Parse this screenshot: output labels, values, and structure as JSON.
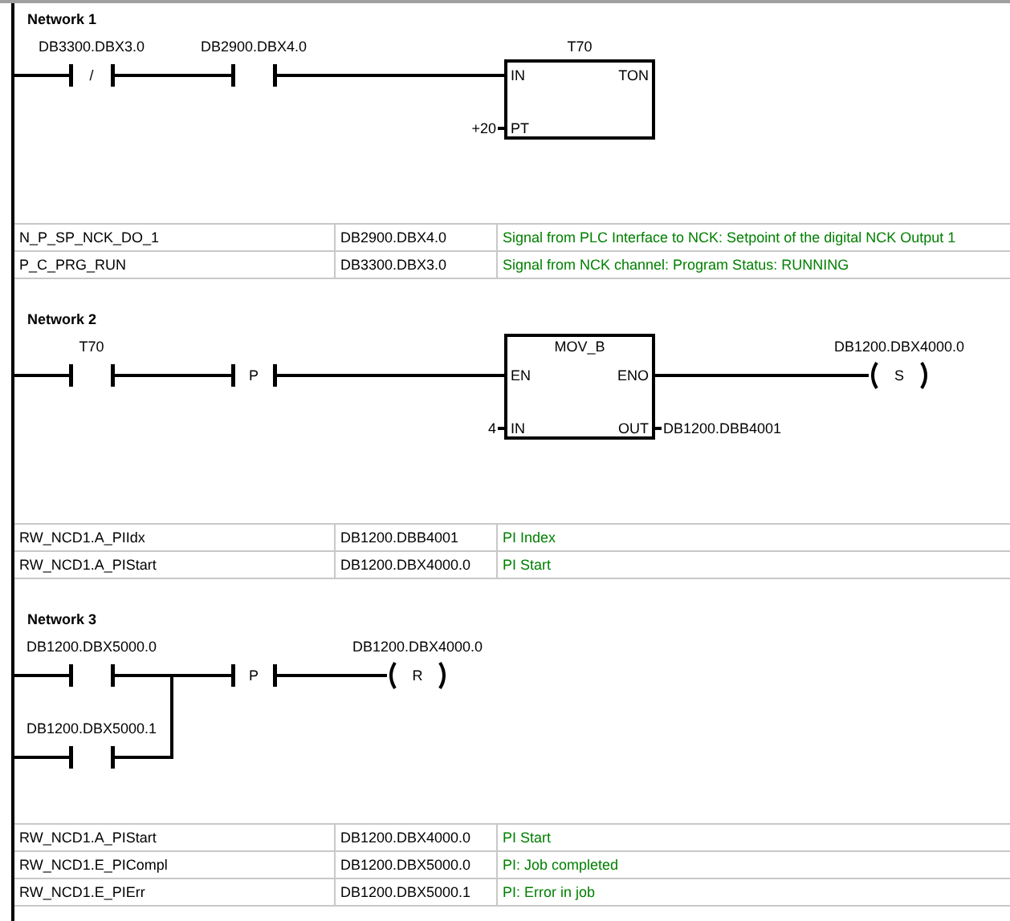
{
  "networks": [
    {
      "title": "Network 1",
      "rung": [
        {
          "kind": "contact",
          "address": "DB3300.DBX3.0",
          "mark": "/"
        },
        {
          "kind": "contact",
          "address": "DB2900.DBX4.0"
        },
        {
          "kind": "timer",
          "name": "T70",
          "type": "TON",
          "inputs": [
            {
              "pin": "IN"
            },
            {
              "pin": "PT",
              "value": "+20"
            }
          ]
        }
      ],
      "symbols": [
        {
          "symbol": "N_P_SP_NCK_DO_1",
          "address": "DB2900.DBX4.0",
          "comment": "Signal from PLC Interface to NCK: Setpoint of the digital NCK Output 1"
        },
        {
          "symbol": "P_C_PRG_RUN",
          "address": "DB3300.DBX3.0",
          "comment": "Signal from NCK channel: Program Status: RUNNING"
        }
      ]
    },
    {
      "title": "Network 2",
      "rung": [
        {
          "kind": "contact",
          "address": "T70"
        },
        {
          "kind": "contact",
          "mark": "P"
        },
        {
          "kind": "move",
          "type": "MOV_B",
          "inputs": [
            {
              "pin": "EN"
            },
            {
              "pin": "IN",
              "value": "4"
            }
          ],
          "outputs": [
            {
              "pin": "ENO"
            },
            {
              "pin": "OUT",
              "value": "DB1200.DBB4001"
            }
          ]
        },
        {
          "kind": "coil",
          "address": "DB1200.DBX4000.0",
          "mark": "S"
        }
      ],
      "symbols": [
        {
          "symbol": "RW_NCD1.A_PIIdx",
          "address": "DB1200.DBB4001",
          "comment": "PI Index"
        },
        {
          "symbol": "RW_NCD1.A_PIStart",
          "address": "DB1200.DBX4000.0",
          "comment": "PI Start"
        }
      ]
    },
    {
      "title": "Network 3",
      "rung": [
        {
          "kind": "branch",
          "contacts": [
            {
              "address": "DB1200.DBX5000.0"
            },
            {
              "address": "DB1200.DBX5000.1"
            }
          ]
        },
        {
          "kind": "contact",
          "mark": "P"
        },
        {
          "kind": "coil",
          "address": "DB1200.DBX4000.0",
          "mark": "R"
        }
      ],
      "symbols": [
        {
          "symbol": "RW_NCD1.A_PIStart",
          "address": "DB1200.DBX4000.0",
          "comment": "PI Start"
        },
        {
          "symbol": "RW_NCD1.E_PICompl",
          "address": "DB1200.DBX5000.0",
          "comment": "PI: Job completed"
        },
        {
          "symbol": "RW_NCD1.E_PIErr",
          "address": "DB1200.DBX5000.1",
          "comment": "PI: Error in job"
        }
      ]
    }
  ]
}
